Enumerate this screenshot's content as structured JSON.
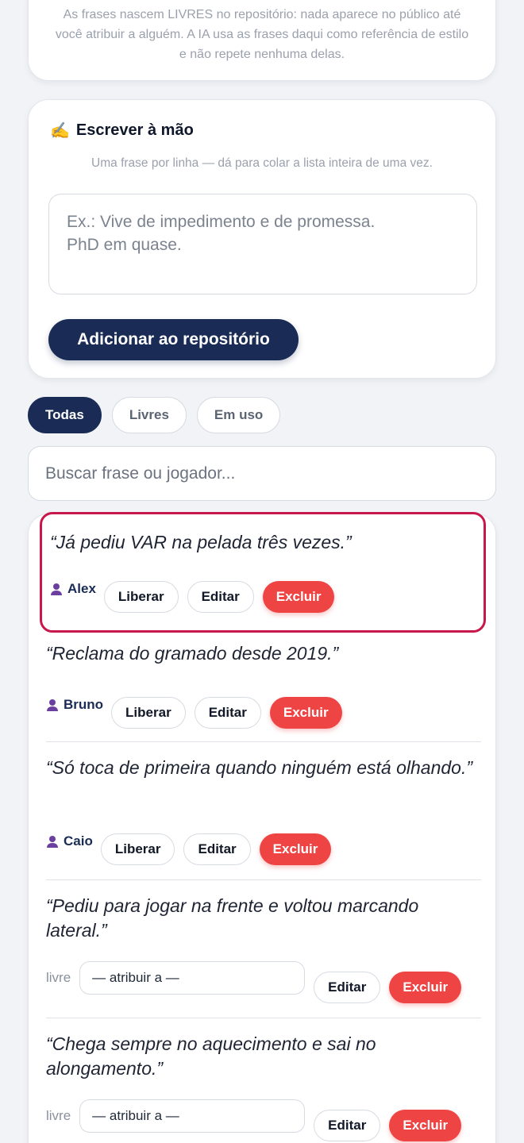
{
  "info": {
    "text": "As frases nascem LIVRES no repositório: nada aparece no público até você atribuir a alguém. A IA usa as frases daqui como referência de estilo e não repete nenhuma delas."
  },
  "manual": {
    "icon": "✍️",
    "title": "Escrever à mão",
    "subtitle": "Uma frase por linha — dá para colar a lista inteira de uma vez.",
    "placeholder": "Ex.: Vive de impedimento e de promessa.\nPhD em quase.",
    "add_button": "Adicionar ao repositório"
  },
  "filters": [
    "Todas",
    "Livres",
    "Em uso"
  ],
  "search": {
    "placeholder": "Buscar frase ou jogador..."
  },
  "phrases": [
    {
      "text": "“Já pediu VAR na pelada três vezes.”",
      "player": "Alex",
      "release": "Liberar",
      "edit": "Editar",
      "delete": "Excluir"
    },
    {
      "text": "“Reclama do gramado desde 2019.”",
      "player": "Bruno",
      "release": "Liberar",
      "edit": "Editar",
      "delete": "Excluir"
    },
    {
      "text": "“Só toca de primeira quando ninguém está olhando.”",
      "player": "Caio",
      "release": "Liberar",
      "edit": "Editar",
      "delete": "Excluir"
    },
    {
      "text": "“Pediu para jogar na frente e voltou marcando lateral.”",
      "status": "livre",
      "assign": "— atribuir a —",
      "edit": "Editar",
      "delete": "Excluir"
    },
    {
      "text": "“Chega sempre no aquecimento e sai no alongamento.”",
      "status": "livre",
      "assign": "— atribuir a —",
      "edit": "Editar",
      "delete": "Excluir"
    }
  ],
  "colors": {
    "primary": "#1a2c55",
    "danger": "#ef4444",
    "highlight": "#c8174a"
  }
}
